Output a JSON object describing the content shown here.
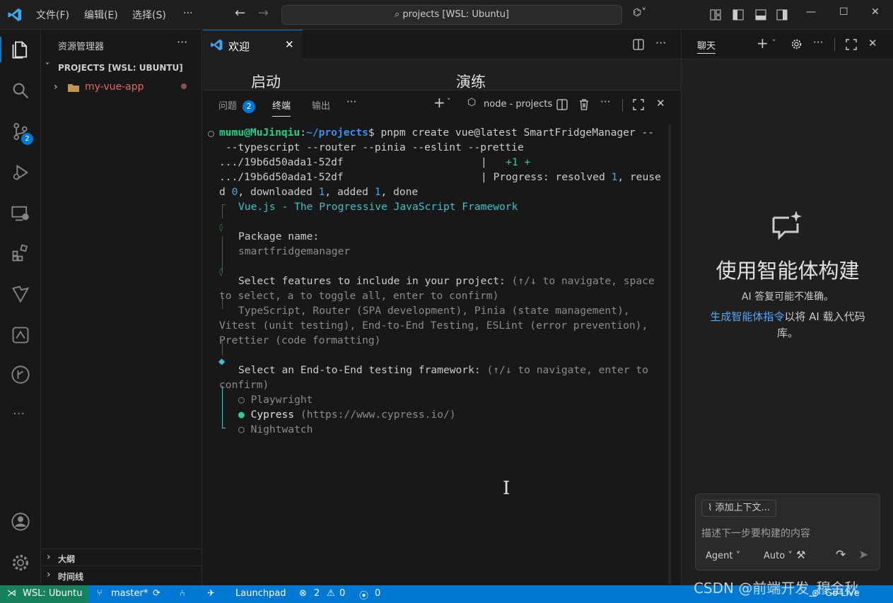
{
  "titlebar": {
    "menus": [
      "文件(F)",
      "编辑(E)",
      "选择(S)",
      "···"
    ],
    "search_text": "projects [WSL: Ubuntu]"
  },
  "sidebar": {
    "title": "资源管理器",
    "section": "PROJECTS [WSL: UBUNTU]",
    "folder": "my-vue-app",
    "outline": "大纲",
    "timeline": "时间线"
  },
  "activity": {
    "badge": "2"
  },
  "editor": {
    "tab_label": "欢迎",
    "welcome_start": "启动",
    "welcome_walkthrough": "演练"
  },
  "panel": {
    "tabs": {
      "problems": "问题",
      "problems_count": "2",
      "terminal": "终端",
      "output": "输出"
    },
    "terminal_name": "node - projects"
  },
  "terminal": {
    "user": "mumu@MuJinqiu",
    "path": "~/projects",
    "cmd": " pnpm create vue@latest SmartFridgeManager --",
    "cmd2": "--typescript --router --pinia --eslint --prettie",
    "r1a": ".../19b6d50ada1-52df",
    "r1b": "+1 +",
    "r2a": ".../19b6d50ada1-52df",
    "r2b": "Progress: resolved ",
    "r2c": "1",
    "r2d": ", reuse",
    "r3a": "d ",
    "r3b": "0",
    "r3c": ", downloaded ",
    "r3d": "1",
    "r3e": ", added ",
    "r3f": "1",
    "r3g": ", done",
    "vue_title": "Vue.js - The Progressive JavaScript Framework",
    "pkg_label": "Package name:",
    "pkg_value": "smartfridgemanager",
    "feat_label": "Select features to include in your project:",
    "feat_hint1": " (↑/↓ to navigate, space",
    "feat_hint2": "to select, a to toggle all, enter to confirm)",
    "feat_sel1": "TypeScript, Router (SPA development), Pinia (state management),",
    "feat_sel2": "Vitest (unit testing), End-to-End Testing, ESLint (error prevention),",
    "feat_sel3": "Prettier (code formatting)",
    "e2e_label": "Select an End-to-End testing framework:",
    "e2e_hint1": " (↑/↓ to navigate, enter to",
    "e2e_hint2": "confirm)",
    "opt1": "Playwright",
    "opt2": "Cypress",
    "opt2_url": "(https://www.cypress.io/)",
    "opt3": "Nightwatch"
  },
  "chat": {
    "tab": "聊天",
    "heading": "使用智能体构建",
    "subtitle": "AI 答复可能不准确。",
    "link": "生成智能体指令",
    "desc1": "以将 AI 载入代码",
    "desc2": "库。",
    "add_context": "添加上下文...",
    "placeholder": "描述下一步要构建的内容",
    "mode": "Agent",
    "model": "Auto"
  },
  "status": {
    "remote": "WSL: Ubuntu",
    "branch": "master*",
    "launchpad": "Launchpad",
    "errors": "2",
    "warnings": "0",
    "ports": "0",
    "golive": "Go Live"
  },
  "watermark": "CSDN @前端开发_穆金秋",
  "colors": {
    "accent": "#0078d4",
    "badge": "#0078d4",
    "folder": "#e8a040",
    "git_modified": "#e2c08d"
  }
}
